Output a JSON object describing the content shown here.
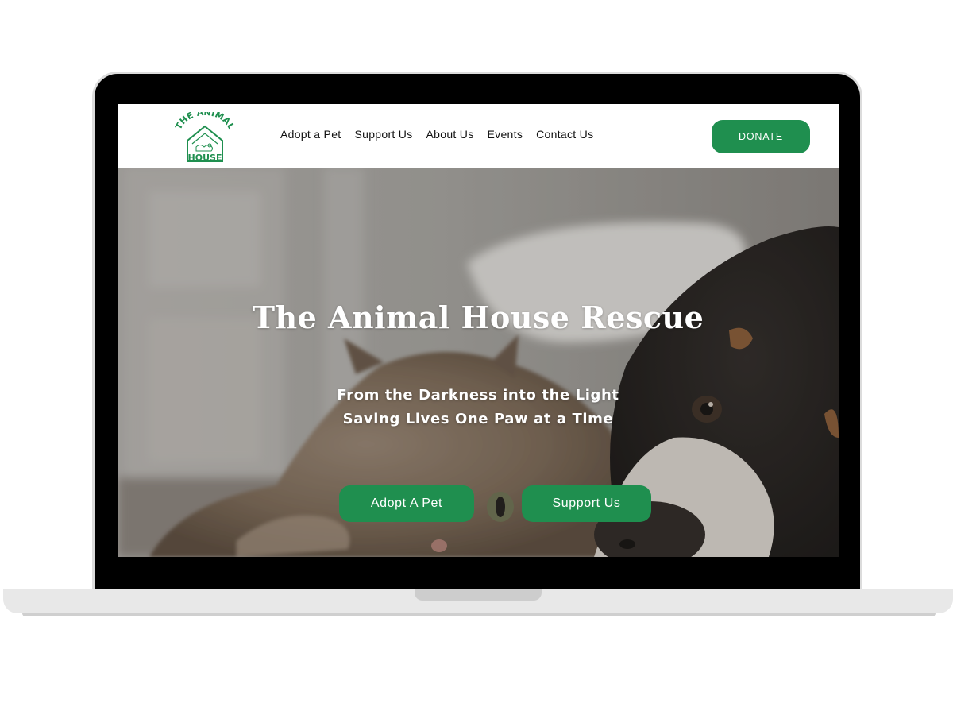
{
  "brand": {
    "logo_top_text": "THE ANIMAL",
    "logo_bottom_text": "HOUSE",
    "logo_color": "#1f8f4f"
  },
  "nav": {
    "items": [
      {
        "label": "Adopt a Pet"
      },
      {
        "label": "Support Us"
      },
      {
        "label": "About Us"
      },
      {
        "label": "Events"
      },
      {
        "label": "Contact Us"
      }
    ],
    "donate_label": "DONATE"
  },
  "hero": {
    "title": "The Animal House Rescue",
    "subtitle_line1": "From the Darkness into the Light",
    "subtitle_line2": "Saving Lives One Paw at a Time",
    "buttons": [
      {
        "label": "Adopt A Pet"
      },
      {
        "label": "Support Us"
      }
    ]
  },
  "colors": {
    "accent": "#1f8f4f",
    "nav_text": "#111111",
    "hero_text": "#ffffff"
  }
}
